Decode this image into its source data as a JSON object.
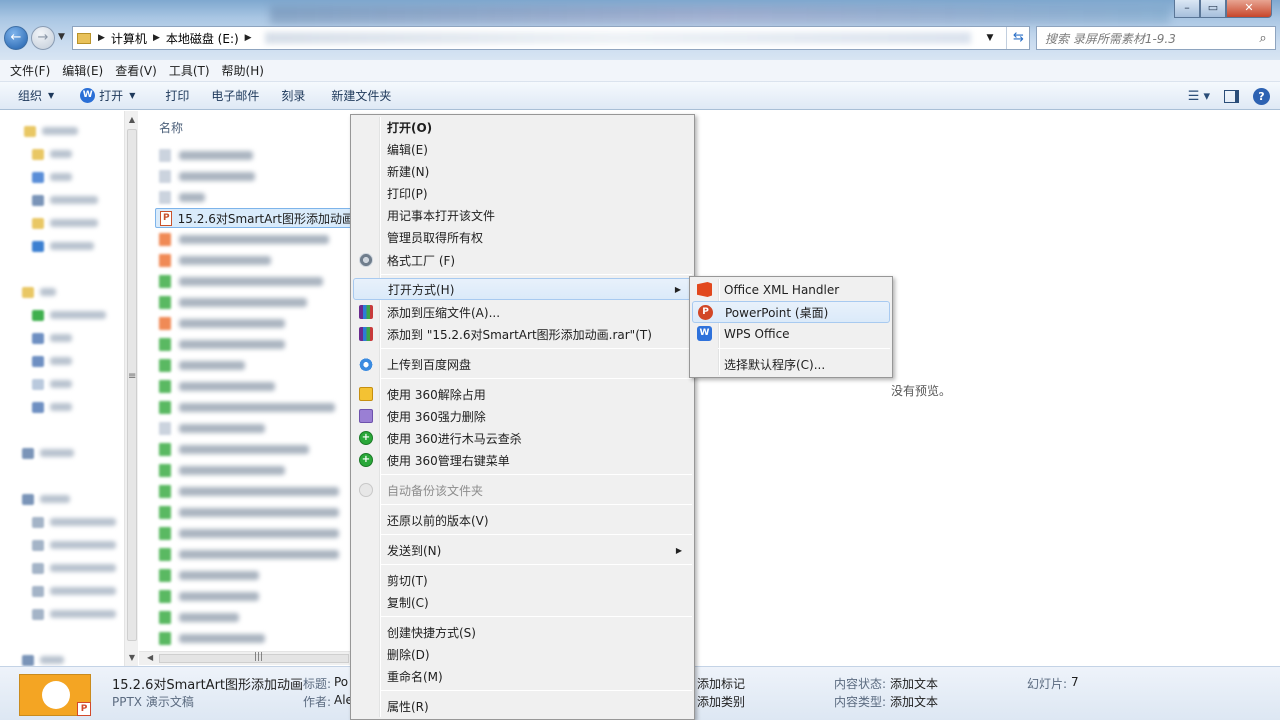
{
  "address": {
    "crumbs": [
      "计算机",
      "本地磁盘 (E:)"
    ]
  },
  "search": {
    "placeholder": "搜索 录屏所需素材1-9.3"
  },
  "menubar": [
    "文件(F)",
    "编辑(E)",
    "查看(V)",
    "工具(T)",
    "帮助(H)"
  ],
  "toolbar": {
    "organize": "组织",
    "open": "打开",
    "print": "打印",
    "email": "电子邮件",
    "burn": "刻录",
    "new_folder": "新建文件夹"
  },
  "filelist": {
    "column_name": "名称",
    "selected_file": "15.2.6对SmartArt图形添加动画"
  },
  "preview": {
    "no_preview": "没有预览。"
  },
  "context_menu": {
    "open": "打开(O)",
    "edit": "编辑(E)",
    "new": "新建(N)",
    "print": "打印(P)",
    "open_notepad": "用记事本打开该文件",
    "take_ownership": "管理员取得所有权",
    "format_factory": "格式工厂 (F)",
    "open_with": "打开方式(H)",
    "add_archive": "添加到压缩文件(A)...",
    "add_rar": "添加到 \"15.2.6对SmartArt图形添加动画.rar\"(T)",
    "upload_baidu": "上传到百度网盘",
    "unlock_360": "使用 360解除占用",
    "force_delete_360": "使用 360强力删除",
    "trojan_scan_360": "使用 360进行木马云查杀",
    "manage_menu_360": "使用 360管理右键菜单",
    "auto_backup": "自动备份该文件夹",
    "restore_versions": "还原以前的版本(V)",
    "send_to": "发送到(N)",
    "cut": "剪切(T)",
    "copy": "复制(C)",
    "create_shortcut": "创建快捷方式(S)",
    "delete": "删除(D)",
    "rename": "重命名(M)",
    "properties": "属性(R)"
  },
  "submenu": {
    "office_xml": "Office XML Handler",
    "powerpoint": "PowerPoint (桌面)",
    "wps": "WPS Office",
    "choose_default": "选择默认程序(C)..."
  },
  "details": {
    "filename": "15.2.6对SmartArt图形添加动画",
    "filetype": "PPTX 演示文稿",
    "title_label": "标题:",
    "title_value": "Po",
    "author_label": "作者:",
    "author_value": "Ale",
    "tags_value": "添加标记",
    "category_value": "添加类别",
    "content_status_label": "内容状态:",
    "content_status_value": "添加文本",
    "content_type_label": "内容类型:",
    "content_type_value": "添加文本",
    "slides_label": "幻灯片:",
    "slides_value": "7"
  }
}
